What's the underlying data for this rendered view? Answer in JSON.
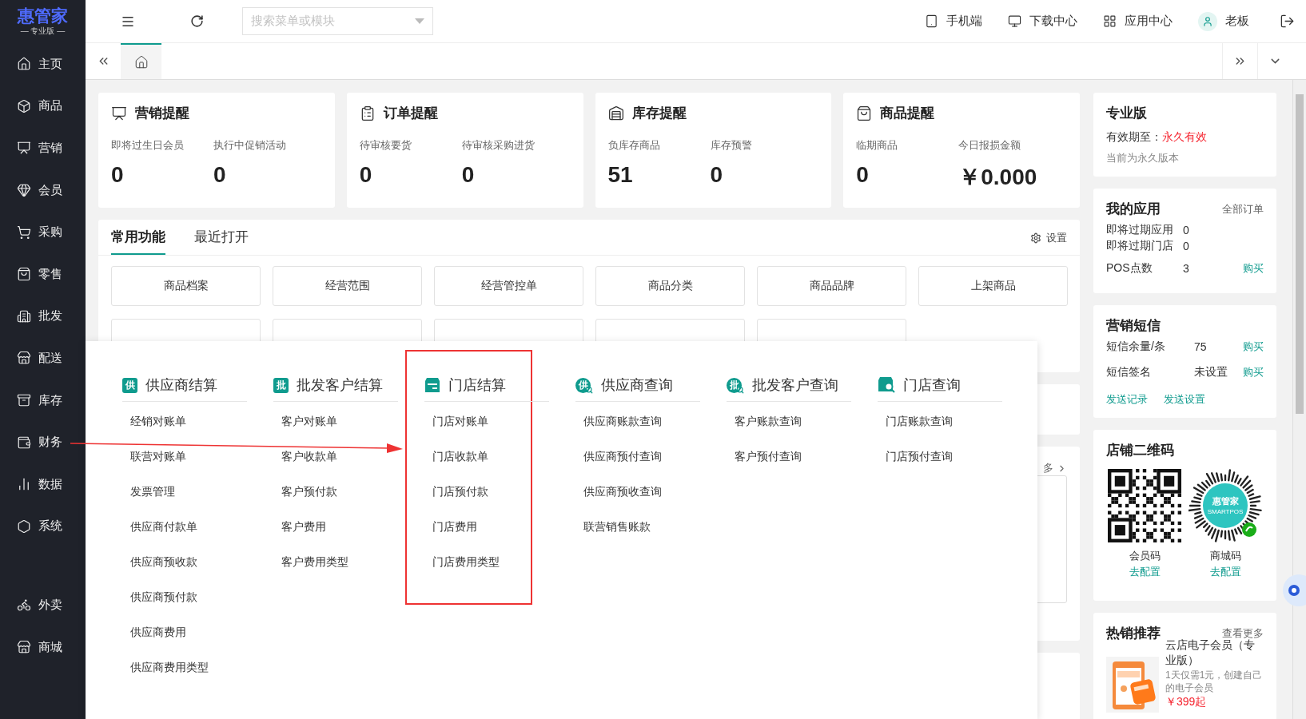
{
  "sidebar": {
    "logo": {
      "name": "惠管家",
      "edition": "— 专业版 —"
    },
    "items": [
      {
        "label": "主页"
      },
      {
        "label": "商品"
      },
      {
        "label": "营销"
      },
      {
        "label": "会员"
      },
      {
        "label": "采购"
      },
      {
        "label": "零售"
      },
      {
        "label": "批发"
      },
      {
        "label": "配送"
      },
      {
        "label": "库存"
      },
      {
        "label": "财务"
      },
      {
        "label": "数据"
      },
      {
        "label": "系统"
      }
    ],
    "extra_items": [
      {
        "label": "外卖"
      },
      {
        "label": "商城"
      }
    ]
  },
  "top_bar": {
    "search_placeholder": "搜索菜单或模块",
    "links": [
      {
        "label": "手机端"
      },
      {
        "label": "下载中心"
      },
      {
        "label": "应用中心"
      }
    ],
    "user": "老板"
  },
  "page_tabs": [
    {
      "kind": "home",
      "selected": true
    }
  ],
  "alert_cards": [
    {
      "title": "营销提醒",
      "stats": [
        {
          "label": "即将过生日会员",
          "value": "0"
        },
        {
          "label": "执行中促销活动",
          "value": "0"
        }
      ]
    },
    {
      "title": "订单提醒",
      "stats": [
        {
          "label": "待审核要货",
          "value": "0"
        },
        {
          "label": "待审核采购进货",
          "value": "0"
        }
      ]
    },
    {
      "title": "库存提醒",
      "stats": [
        {
          "label": "负库存商品",
          "value": "51"
        },
        {
          "label": "库存预警",
          "value": "0"
        }
      ]
    },
    {
      "title": "商品提醒",
      "stats": [
        {
          "label": "临期商品",
          "value": "0"
        },
        {
          "label": "今日报损金额",
          "value": "￥0.000"
        }
      ]
    }
  ],
  "functions": {
    "tabs": [
      {
        "label": "常用功能",
        "selected": true
      },
      {
        "label": "最近打开",
        "selected": false
      }
    ],
    "settings": "设置",
    "buttons": [
      "商品档案",
      "经营范围",
      "经营管控单",
      "商品分类",
      "商品品牌",
      "上架商品"
    ],
    "covered_buttons": [
      {
        "kind": "covered"
      },
      {
        "kind": "covered"
      },
      {
        "kind": "covered"
      },
      {
        "kind": "covered"
      },
      {
        "kind": "covered"
      }
    ]
  },
  "lower_panel": {
    "more_link": "多"
  },
  "dropdown": {
    "columns": [
      {
        "title": "供应商结算",
        "highlighted": false,
        "icon": {
          "kind": "letter",
          "text": "供"
        },
        "items": [
          "经销对账单",
          "联营对账单",
          "发票管理",
          "供应商付款单",
          "供应商预收款",
          "供应商预付款",
          "供应商费用",
          "供应商费用类型"
        ]
      },
      {
        "title": "批发客户结算",
        "highlighted": false,
        "icon": {
          "kind": "letter",
          "text": "批"
        },
        "items": [
          "客户对账单",
          "客户收款单",
          "客户预付款",
          "客户费用",
          "客户费用类型"
        ]
      },
      {
        "title": "门店结算",
        "highlighted": true,
        "icon": {
          "kind": "store"
        },
        "items": [
          "门店对账单",
          "门店收款单",
          "门店预付款",
          "门店费用",
          "门店费用类型"
        ]
      },
      {
        "title": "供应商查询",
        "highlighted": false,
        "icon": {
          "kind": "letter_search",
          "text": "供"
        },
        "items": [
          "供应商账款查询",
          "供应商预付查询",
          "供应商预收查询",
          "联营销售账款"
        ]
      },
      {
        "title": "批发客户查询",
        "highlighted": false,
        "icon": {
          "kind": "letter_search",
          "text": "批"
        },
        "items": [
          "客户账款查询",
          "客户预付查询"
        ]
      },
      {
        "title": "门店查询",
        "highlighted": false,
        "icon": {
          "kind": "store_search"
        },
        "items": [
          "门店账款查询",
          "门店预付查询"
        ]
      }
    ]
  },
  "annotation_arrow": true,
  "right": {
    "edition": {
      "title": "专业版",
      "validity_label": "有效期至：",
      "validity_value": "永久有效",
      "note": "当前为永久版本"
    },
    "my_apps": {
      "title": "我的应用",
      "link": "全部订单",
      "rows": [
        {
          "label": "即将过期应用",
          "value": "0"
        },
        {
          "label": "即将过期门店",
          "value": "0"
        },
        {
          "label": "POS点数",
          "value": "3",
          "action": "购买"
        }
      ]
    },
    "sms": {
      "title": "营销短信",
      "rows": [
        {
          "label": "短信余量/条",
          "value": "75",
          "action": "购买"
        },
        {
          "label": "短信签名",
          "value": "未设置",
          "action": "购买"
        }
      ],
      "links": [
        "发送记录",
        "发送设置"
      ]
    },
    "qr": {
      "title": "店铺二维码",
      "codes": [
        {
          "kind": "qr",
          "label": "会员码",
          "action": "去配置"
        },
        {
          "kind": "mini",
          "label": "商城码",
          "action": "去配置",
          "logo": "惠管家",
          "logo_sub": "SMARTPOS"
        }
      ]
    },
    "hot": {
      "title": "热销推荐",
      "link": "查看更多",
      "product": {
        "kind": "picture",
        "name": "云店电子会员（专业版）",
        "desc": "1天仅需1元，创建自己的电子会员",
        "price": "￥399起"
      }
    }
  }
}
